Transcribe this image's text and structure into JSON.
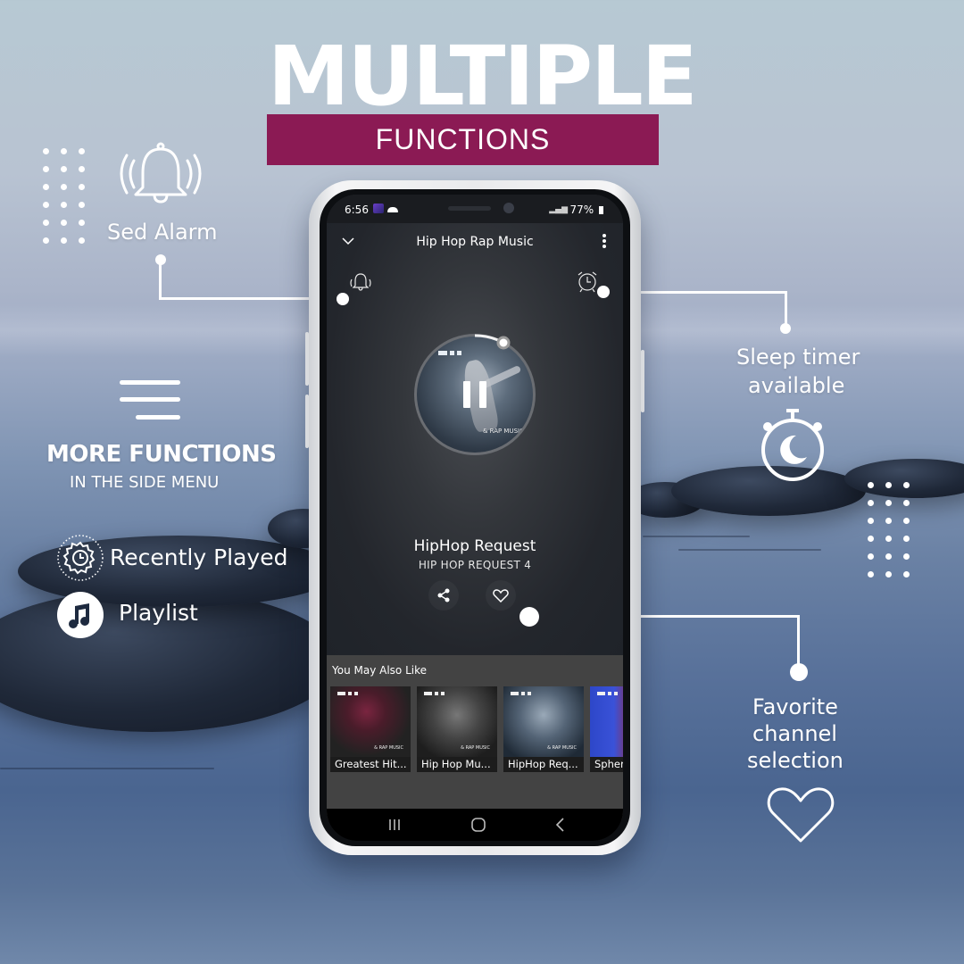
{
  "headline": {
    "title": "MULTIPLE",
    "subtitle": "FUNCTIONS",
    "band_color": "#8b1a54"
  },
  "features": {
    "alarm": {
      "label": "Sed Alarm",
      "icon": "bell-ringing-icon"
    },
    "side_menu": {
      "title": "MORE FUNCTIONS",
      "subtitle": "IN THE SIDE MENU",
      "icon": "hamburger-menu-icon"
    },
    "recently_played": {
      "label": "Recently Played",
      "icon": "history-gear-icon"
    },
    "playlist": {
      "label": "Playlist",
      "icon": "music-note-icon"
    },
    "sleep_timer": {
      "line1": "Sleep timer",
      "line2": "available",
      "icon": "stopwatch-moon-icon"
    },
    "favorite": {
      "line1": "Favorite",
      "line2": "channel",
      "line3": "selection",
      "icon": "heart-outline-icon"
    }
  },
  "phone": {
    "status_bar": {
      "time": "6:56",
      "battery": "77%"
    },
    "header": {
      "title": "Hip Hop Rap Music",
      "back_icon": "chevron-down-icon",
      "menu_icon": "more-vertical-icon"
    },
    "player": {
      "alarm_icon": "bell-ringing-icon",
      "timer_icon": "alarm-clock-icon",
      "cover_text": "& RAP MUSIC",
      "state": "playing",
      "track_title": "HipHop Request",
      "track_subtitle": "HIP HOP REQUEST 4",
      "share_icon": "share-icon",
      "favorite_icon": "heart-outline-icon"
    },
    "recommendations": {
      "title": "You May Also Like",
      "items": [
        {
          "label": "Greatest Hit...",
          "brand": "& RAP MUSIC"
        },
        {
          "label": "Hip Hop Mu...",
          "brand": "& RAP MUSIC"
        },
        {
          "label": "HipHop Req...",
          "brand": "& RAP MUSIC"
        },
        {
          "label": "Spher",
          "brand": ""
        }
      ]
    },
    "nav": {
      "recents_icon": "recent-apps-icon",
      "home_icon": "home-icon",
      "back_icon": "back-icon"
    }
  }
}
